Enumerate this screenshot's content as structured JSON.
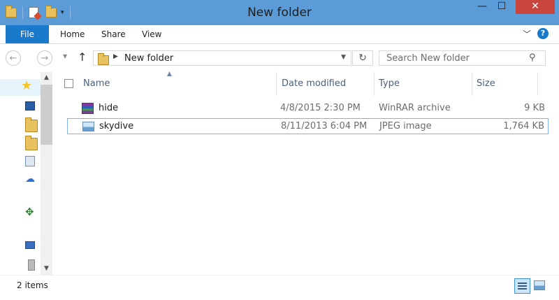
{
  "window": {
    "title": "New folder",
    "controls": {
      "minimize": "—",
      "maximize": "☐",
      "close": "✕"
    }
  },
  "ribbon": {
    "tabs": [
      {
        "label": "File"
      },
      {
        "label": "Home"
      },
      {
        "label": "Share"
      },
      {
        "label": "View"
      }
    ],
    "help": "?"
  },
  "address": {
    "path": "New folder",
    "search_placeholder": "Search New folder"
  },
  "file_list": {
    "columns": [
      "Name",
      "Date modified",
      "Type",
      "Size"
    ],
    "rows": [
      {
        "name": "hide",
        "date": "4/8/2015 2:30 PM",
        "type": "WinRAR archive",
        "size": "9 KB",
        "icon": "winrar-archive-icon"
      },
      {
        "name": "skydive",
        "date": "8/11/2013 6:04 PM",
        "type": "JPEG image",
        "size": "1,764 KB",
        "icon": "image-file-icon",
        "selected": true
      }
    ]
  },
  "status": {
    "item_count": "2 items"
  },
  "colors": {
    "accent": "#1979ca",
    "titlebar": "#5b9bd8",
    "close": "#c7453c",
    "selection_border": "#7eb4ea"
  }
}
